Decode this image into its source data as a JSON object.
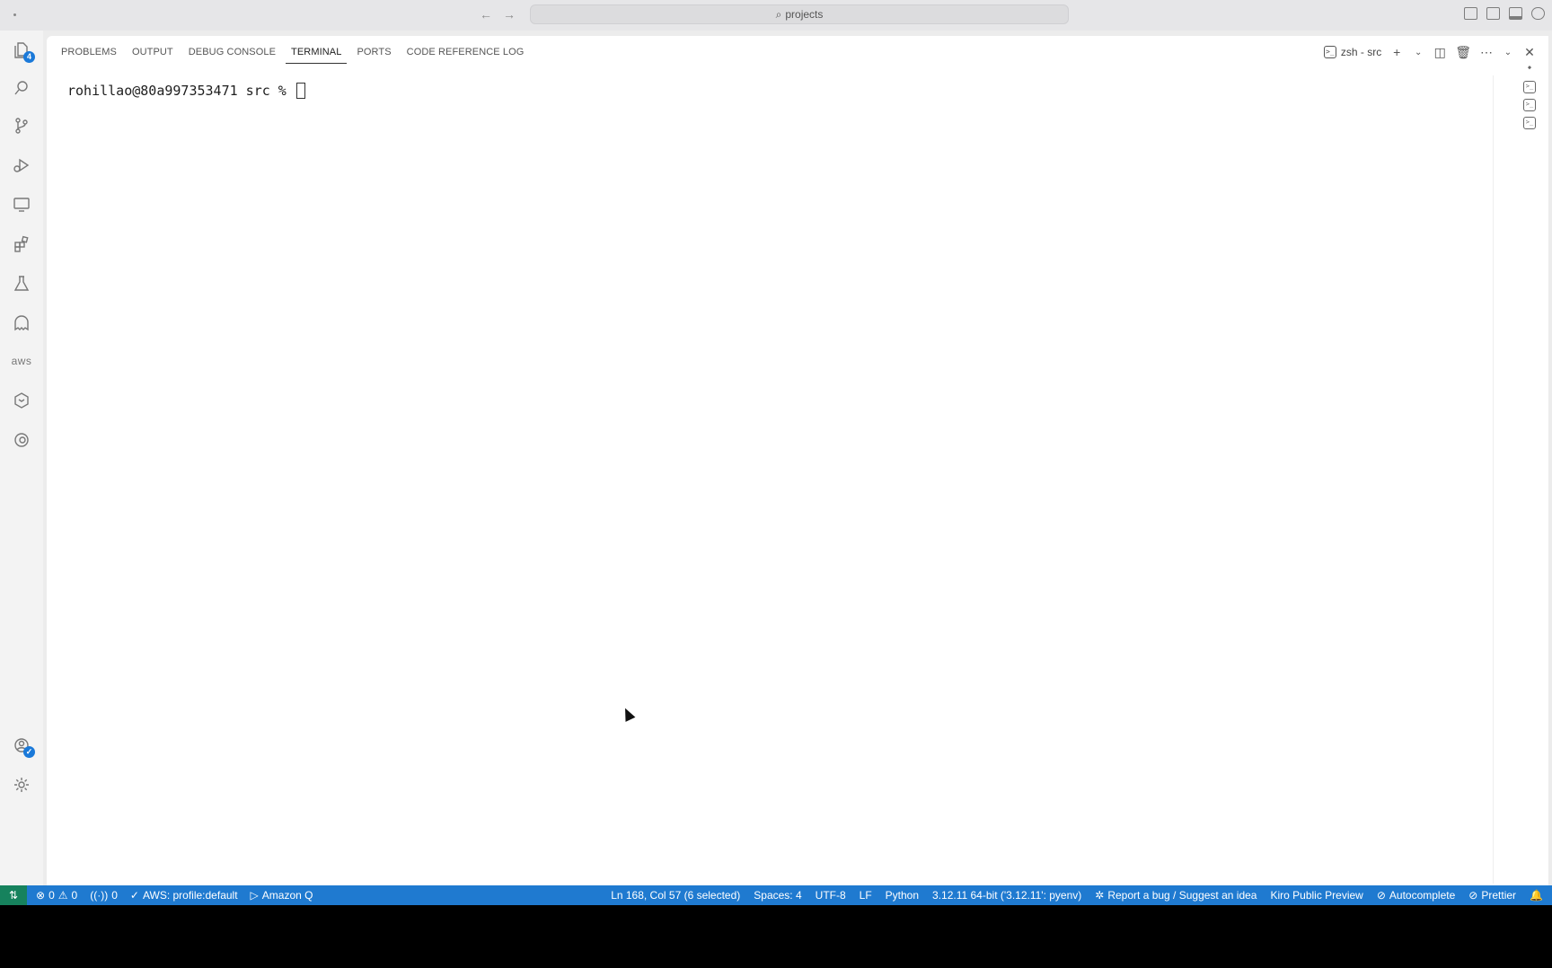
{
  "titlebar": {
    "command_center_text": "projects"
  },
  "activity_bar": {
    "explorer_badge": "4",
    "aws_label": "aws"
  },
  "panel": {
    "tabs": [
      {
        "label": "PROBLEMS"
      },
      {
        "label": "OUTPUT"
      },
      {
        "label": "DEBUG CONSOLE"
      },
      {
        "label": "TERMINAL",
        "active": true
      },
      {
        "label": "PORTS"
      },
      {
        "label": "CODE REFERENCE LOG"
      }
    ],
    "terminal_name": "zsh - src"
  },
  "terminal": {
    "prompt": "rohillao@80a997353471 src % "
  },
  "statusbar": {
    "errors": "0",
    "warnings": "0",
    "ports": "0",
    "aws_profile": "AWS: profile:default",
    "amazon_q": "Amazon Q",
    "cursor_position": "Ln 168, Col 57 (6 selected)",
    "spaces": "Spaces: 4",
    "encoding": "UTF-8",
    "eol": "LF",
    "language": "Python",
    "interpreter": "3.12.11 64-bit ('3.12.11': pyenv)",
    "report_bug": "Report a bug / Suggest an idea",
    "kiro": "Kiro Public Preview",
    "autocomplete": "Autocomplete",
    "prettier": "Prettier"
  },
  "colors": {
    "statusbar": "#1f7ad0",
    "remote": "#16825d",
    "badge": "#1a79d9"
  }
}
